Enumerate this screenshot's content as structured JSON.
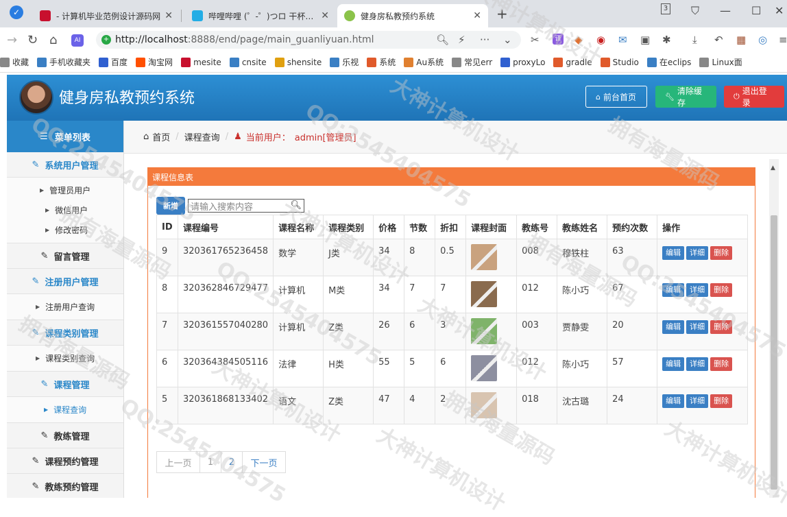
{
  "browser": {
    "tabs": [
      {
        "title": "- 计算机毕业范例设计源码网",
        "favicon_color": "#c8102e"
      },
      {
        "title": "哔哩哔哩 (゜-゜)つロ 干杯~-bilibili",
        "favicon_color": "#23ade5"
      },
      {
        "title": "健身房私教预约系统",
        "favicon_color": "#8bc34a"
      }
    ],
    "new_tab": "+",
    "tab_count_badge": "3",
    "url_host": "http://localhost",
    "url_path": ":8888/end/page/main_guanliyuan.html",
    "bookmarks": [
      {
        "label": "收藏",
        "color": "#888"
      },
      {
        "label": "手机收藏夹",
        "color": "#3a7fc4"
      },
      {
        "label": "百度",
        "color": "#3060d0"
      },
      {
        "label": "淘宝网",
        "color": "#ff5000"
      },
      {
        "label": "mesite",
        "color": "#c8102e"
      },
      {
        "label": "cnsite",
        "color": "#3a7fc4"
      },
      {
        "label": "shensite",
        "color": "#e0a010"
      },
      {
        "label": "乐视",
        "color": "#3a7fc4"
      },
      {
        "label": "系统",
        "color": "#e05a2b"
      },
      {
        "label": "Au系统",
        "color": "#e08030"
      },
      {
        "label": "常见err",
        "color": "#888"
      },
      {
        "label": "proxyLo",
        "color": "#3060d0"
      },
      {
        "label": "gradle",
        "color": "#e05a2b"
      },
      {
        "label": "Studio",
        "color": "#e05a2b"
      },
      {
        "label": "在eclips",
        "color": "#3a7fc4"
      },
      {
        "label": "Linux面",
        "color": "#888"
      }
    ]
  },
  "header": {
    "title": "健身房私教预约系统",
    "btn_front": "前台首页",
    "btn_cache": "清除缓存",
    "btn_logout": "退出登录"
  },
  "sidebar": {
    "heading": "菜单列表",
    "groups": [
      {
        "label": "系统用户管理",
        "subs": [
          "管理员用户",
          "微信用户",
          "修改密码"
        ]
      },
      {
        "label": "留言管理",
        "subs": []
      },
      {
        "label": "注册用户管理",
        "subs": [
          "注册用户查询"
        ]
      },
      {
        "label": "课程类别管理",
        "subs": [
          "课程类别查询"
        ]
      },
      {
        "label": "课程管理",
        "subs": [
          "课程查询"
        ]
      },
      {
        "label": "教练管理",
        "subs": []
      },
      {
        "label": "课程预约管理",
        "subs": []
      },
      {
        "label": "教练预约管理",
        "subs": []
      }
    ]
  },
  "breadcrumb": {
    "home": "首页",
    "current": "课程查询",
    "user_label": "当前用户：",
    "user_value": "admin[管理员]"
  },
  "panel": {
    "title": "课程信息表",
    "add_label": "新增",
    "search_placeholder": "请输入搜索内容",
    "columns": [
      "ID",
      "课程编号",
      "课程名称",
      "课程类别",
      "价格",
      "节数",
      "折扣",
      "课程封面",
      "教练号",
      "教练姓名",
      "预约次数",
      "操作"
    ],
    "rows": [
      {
        "id": "9",
        "code": "320361765236458",
        "name": "数学",
        "cat": "J类",
        "price": "34",
        "sessions": "8",
        "discount": "0.5",
        "coach_no": "008",
        "coach": "穆铁柱",
        "count": "63",
        "thumb": "#c9a27e"
      },
      {
        "id": "8",
        "code": "320362846729477",
        "name": "计算机",
        "cat": "M类",
        "price": "34",
        "sessions": "7",
        "discount": "7",
        "coach_no": "012",
        "coach": "陈小巧",
        "count": "67",
        "thumb": "#8a6b4e"
      },
      {
        "id": "7",
        "code": "320361557040280",
        "name": "计算机",
        "cat": "Z类",
        "price": "26",
        "sessions": "6",
        "discount": "3",
        "coach_no": "003",
        "coach": "贾静雯",
        "count": "20",
        "thumb": "#7fb36a"
      },
      {
        "id": "6",
        "code": "320364384505116",
        "name": "法律",
        "cat": "H类",
        "price": "55",
        "sessions": "5",
        "discount": "6",
        "coach_no": "012",
        "coach": "陈小巧",
        "count": "57",
        "thumb": "#8d8fa0"
      },
      {
        "id": "5",
        "code": "320361868133402",
        "name": "语文",
        "cat": "Z类",
        "price": "47",
        "sessions": "4",
        "discount": "2",
        "coach_no": "018",
        "coach": "沈古璐",
        "count": "24",
        "thumb": "#d8c4b0"
      }
    ],
    "op_edit": "编辑",
    "op_detail": "详细",
    "op_delete": "删除",
    "pager": {
      "prev": "上一页",
      "p1": "1",
      "p2": "2",
      "next": "下一页"
    }
  },
  "watermarks": [
    "大神计算机设计",
    "拥有海量源码",
    "QQ:2545404575"
  ]
}
